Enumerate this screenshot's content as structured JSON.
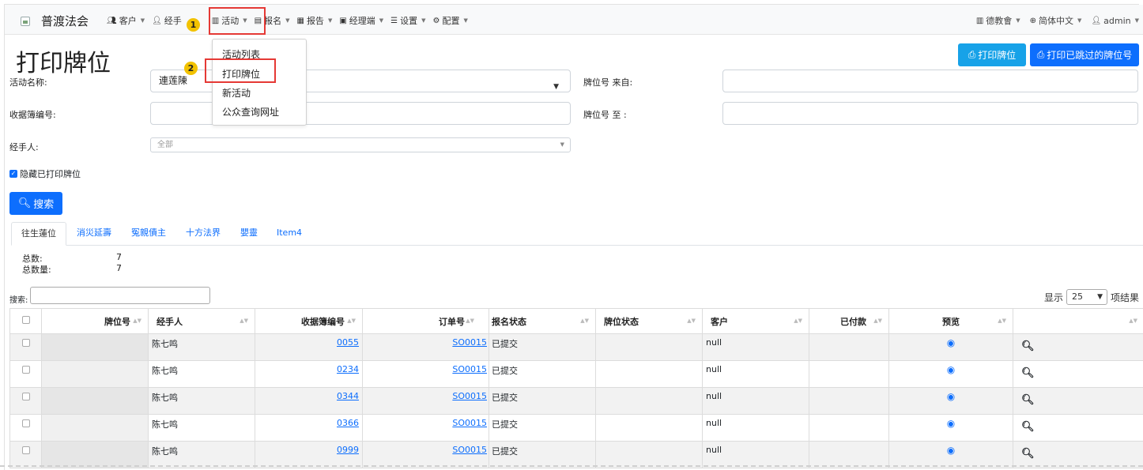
{
  "navbar": {
    "brand": "普渡法会",
    "items": [
      {
        "label": "客户",
        "icon": "users-icon"
      },
      {
        "label": "经手",
        "icon": "user-icon"
      },
      {
        "label": "活动",
        "icon": "map-icon"
      },
      {
        "label": "报名",
        "icon": "form-icon"
      },
      {
        "label": "报告",
        "icon": "report-icon"
      },
      {
        "label": "经理端",
        "icon": "briefcase-icon"
      },
      {
        "label": "设置",
        "icon": "sliders-icon"
      },
      {
        "label": "配置",
        "icon": "gear-icon"
      }
    ],
    "right": [
      {
        "label": "德教會",
        "icon": "building-icon"
      },
      {
        "label": "简体中文",
        "icon": "globe-icon"
      },
      {
        "label": "admin",
        "icon": "user-icon"
      }
    ]
  },
  "annotations": {
    "step1": "1",
    "step2": "2"
  },
  "dropdown": {
    "items": [
      "活动列表",
      "打印牌位",
      "新活动",
      "公众查询网址"
    ]
  },
  "page": {
    "title": "打印牌位",
    "btn_print": "打印牌位",
    "btn_print_skipped": "打印已跳过的牌位号"
  },
  "form": {
    "activity_label": "活动名称:",
    "activity_value": "連莲陳",
    "receipt_label": "收据簿编号:",
    "handler_label": "经手人:",
    "handler_value": "全部",
    "from_label": "牌位号 来自:",
    "to_label": "牌位号 至 :",
    "hide_printed": "隐藏已打印牌位",
    "search_btn": "搜索"
  },
  "tabs": [
    "往生蓮位",
    "消災延壽",
    "冤親債主",
    "十方法界",
    "嬰靈",
    "Item4"
  ],
  "stats": {
    "total_label": "总数:",
    "total_value": "7",
    "qty_label": "总数量:",
    "qty_value": "7"
  },
  "table": {
    "search_label": "搜索:",
    "show_prefix": "显示",
    "page_size": "25",
    "show_suffix": "项结果",
    "columns": [
      "",
      "牌位号",
      "经手人",
      "收据簿编号",
      "订单号",
      "报名状态",
      "牌位状态",
      "客户",
      "已付款",
      "预览",
      ""
    ],
    "rows": [
      {
        "slot": "",
        "handler": "陈七鸣",
        "receipt": "0055",
        "order": "SO0015",
        "status": "已提交",
        "slot_status": "",
        "customer": "null",
        "paid": ""
      },
      {
        "slot": "",
        "handler": "陈七鸣",
        "receipt": "0234",
        "order": "SO0015",
        "status": "已提交",
        "slot_status": "",
        "customer": "null",
        "paid": ""
      },
      {
        "slot": "",
        "handler": "陈七鸣",
        "receipt": "0344",
        "order": "SO0015",
        "status": "已提交",
        "slot_status": "",
        "customer": "null",
        "paid": ""
      },
      {
        "slot": "",
        "handler": "陈七鸣",
        "receipt": "0366",
        "order": "SO0015",
        "status": "已提交",
        "slot_status": "",
        "customer": "null",
        "paid": ""
      },
      {
        "slot": "",
        "handler": "陈七鸣",
        "receipt": "0999",
        "order": "SO0015",
        "status": "已提交",
        "slot_status": "",
        "customer": "null",
        "paid": ""
      }
    ]
  },
  "colors": {
    "primary": "#0d6efd",
    "info": "#17a2e8",
    "highlight": "#e53935",
    "badge": "#f2c200"
  }
}
